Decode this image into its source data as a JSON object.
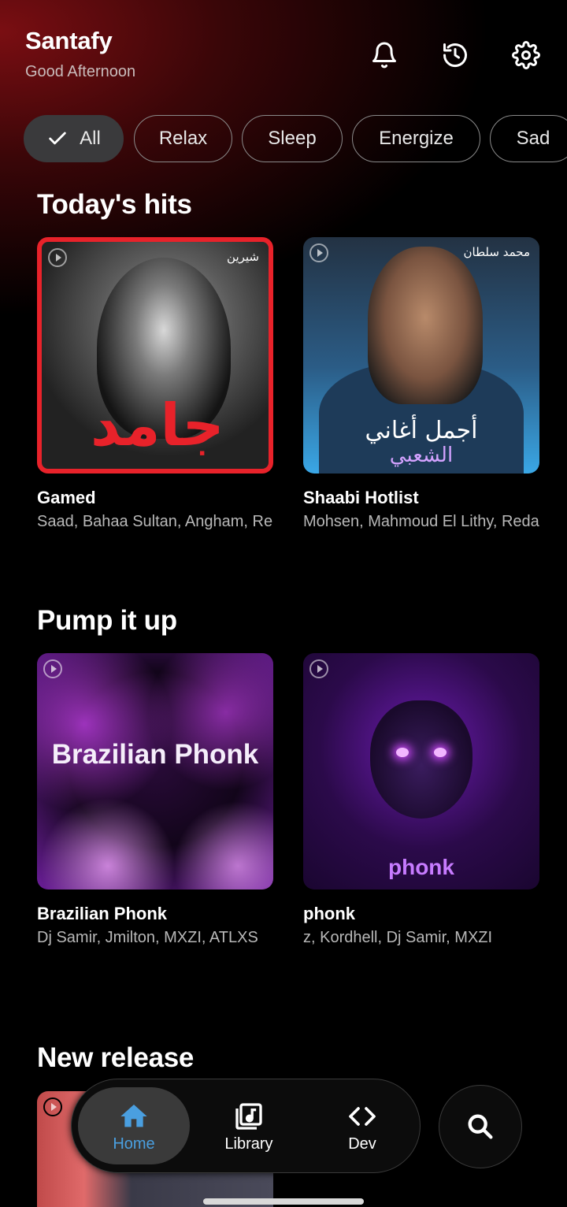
{
  "header": {
    "app_title": "Santafy",
    "greeting": "Good Afternoon",
    "icons": [
      "bell-icon",
      "history-icon",
      "settings-icon"
    ]
  },
  "chips": [
    {
      "label": "All",
      "selected": true
    },
    {
      "label": "Relax",
      "selected": false
    },
    {
      "label": "Sleep",
      "selected": false
    },
    {
      "label": "Energize",
      "selected": false
    },
    {
      "label": "Sad",
      "selected": false
    }
  ],
  "sections": [
    {
      "title": "Today's hits",
      "cards": [
        {
          "title": "Gamed",
          "subtitle": "Saad, Bahaa Sultan, Angham, Red",
          "cover_tag": "شيرين",
          "cover_text": "جامد"
        },
        {
          "title": "Shaabi Hotlist",
          "subtitle": "Mohsen, Mahmoud El Lithy, Reda E",
          "cover_tag": "محمد سلطان",
          "cover_text_1": "أجمل أغاني",
          "cover_text_2": "الشعبي"
        }
      ]
    },
    {
      "title": "Pump it up",
      "cards": [
        {
          "title": "Brazilian Phonk",
          "subtitle": "Dj Samir, Jmilton, MXZI, ATLXS",
          "cover_text": "Brazilian Phonk"
        },
        {
          "title": "phonk",
          "subtitle": "z, Kordhell, Dj Samir, MXZI",
          "cover_text": "phonk"
        }
      ]
    },
    {
      "title": "New release",
      "cards": []
    }
  ],
  "bottom_nav": {
    "items": [
      {
        "label": "Home",
        "icon": "home-icon",
        "active": true
      },
      {
        "label": "Library",
        "icon": "library-icon",
        "active": false
      },
      {
        "label": "Dev",
        "icon": "code-icon",
        "active": false
      }
    ],
    "search_icon": "search-icon"
  },
  "colors": {
    "accent": "#4a9fe0",
    "background": "#000000",
    "header_glow": "#7a0e12",
    "chip_selected": "#3a3a3c"
  }
}
